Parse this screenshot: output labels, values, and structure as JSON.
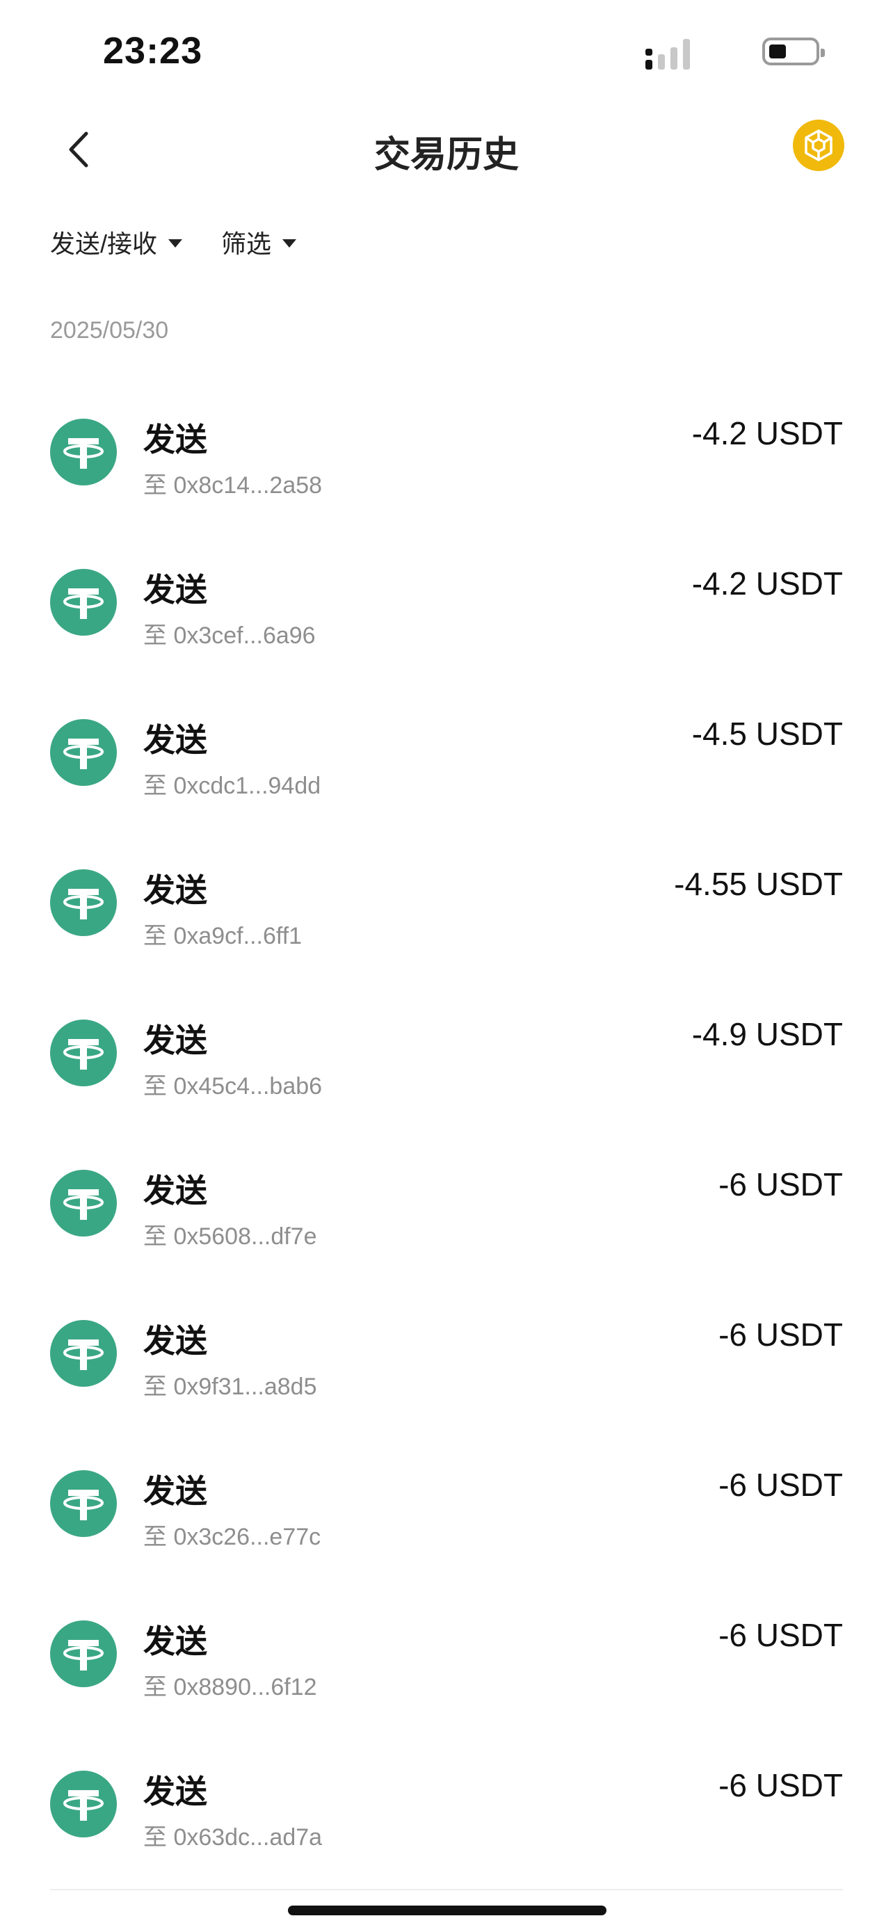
{
  "status_bar": {
    "time": "23:23"
  },
  "nav": {
    "title": "交易历史",
    "back_icon": "chevron-left-icon",
    "chain_icon": "bnb-chain-icon",
    "chain_color": "#F0B90B"
  },
  "filters": [
    {
      "label": "发送/接收"
    },
    {
      "label": "筛选"
    }
  ],
  "date_header": "2025/05/30",
  "token_icon": {
    "name": "usdt-tether-icon",
    "color": "#3AA784"
  },
  "transactions": [
    {
      "type": "发送",
      "address": "至 0x8c14...2a58",
      "amount": "-4.2 USDT"
    },
    {
      "type": "发送",
      "address": "至 0x3cef...6a96",
      "amount": "-4.2 USDT"
    },
    {
      "type": "发送",
      "address": "至 0xcdc1...94dd",
      "amount": "-4.5 USDT"
    },
    {
      "type": "发送",
      "address": "至 0xa9cf...6ff1",
      "amount": "-4.55 USDT"
    },
    {
      "type": "发送",
      "address": "至 0x45c4...bab6",
      "amount": "-4.9 USDT"
    },
    {
      "type": "发送",
      "address": "至 0x5608...df7e",
      "amount": "-6 USDT"
    },
    {
      "type": "发送",
      "address": "至 0x9f31...a8d5",
      "amount": "-6 USDT"
    },
    {
      "type": "发送",
      "address": "至 0x3c26...e77c",
      "amount": "-6 USDT"
    },
    {
      "type": "发送",
      "address": "至 0x8890...6f12",
      "amount": "-6 USDT"
    },
    {
      "type": "发送",
      "address": "至 0x63dc...ad7a",
      "amount": "-6 USDT"
    }
  ]
}
